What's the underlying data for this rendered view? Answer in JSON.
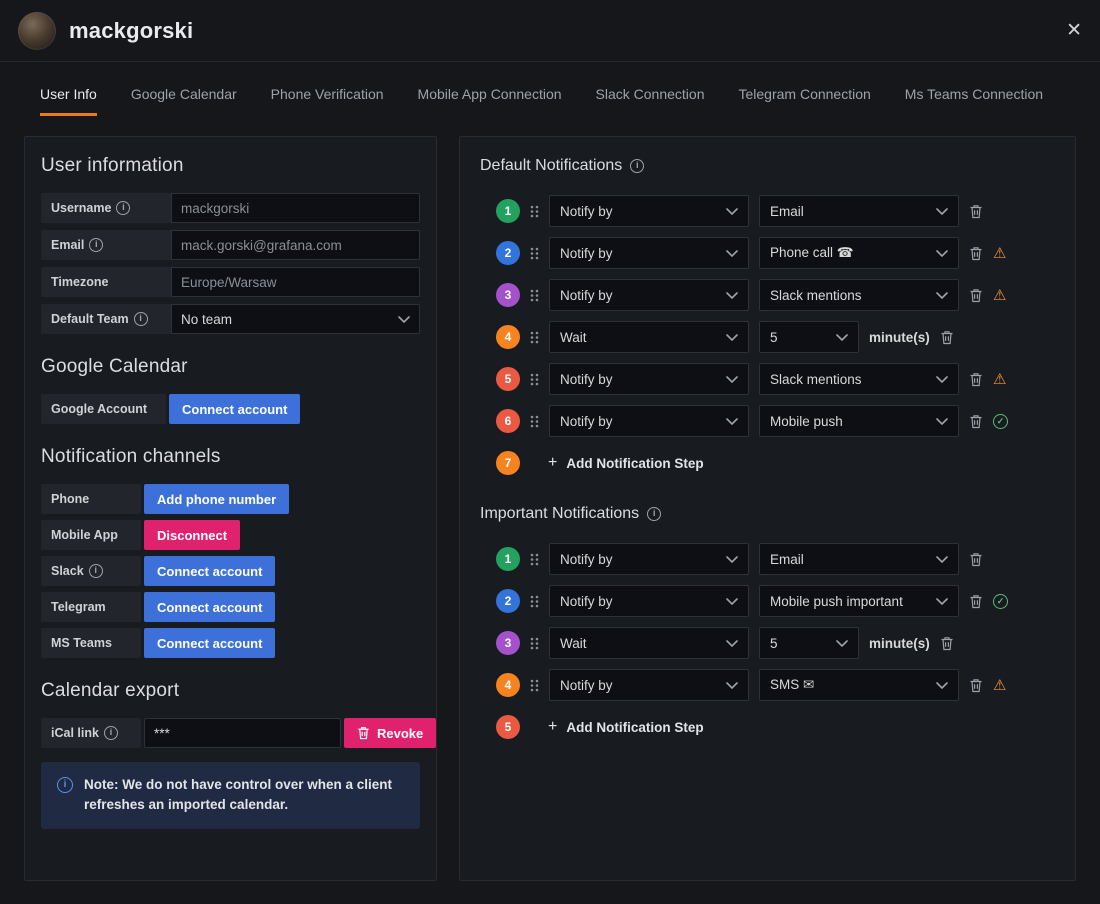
{
  "colors": {
    "primary_button": "#3d71d9",
    "danger_button": "#e0226e",
    "active_tab_accent": "#eb7b18",
    "warning_icon": "#f6953b",
    "success_icon": "#5cb97a",
    "note_info_icon": "#5794f2"
  },
  "icons": {
    "close": "✕",
    "info": "i",
    "warning": "⚠",
    "check": "✓",
    "plus": "+"
  },
  "header": {
    "title": "mackgorski"
  },
  "tabs": [
    {
      "label": "User Info"
    },
    {
      "label": "Google Calendar"
    },
    {
      "label": "Phone Verification"
    },
    {
      "label": "Mobile App Connection"
    },
    {
      "label": "Slack Connection"
    },
    {
      "label": "Telegram Connection"
    },
    {
      "label": "Ms Teams Connection"
    }
  ],
  "user_info": {
    "heading": "User information",
    "fields": [
      {
        "label": "Username",
        "info": true,
        "value": "mackgorski"
      },
      {
        "label": "Email",
        "info": true,
        "value": "mack.gorski@grafana.com"
      },
      {
        "label": "Timezone",
        "info": false,
        "value": "Europe/Warsaw"
      },
      {
        "label": "Default Team",
        "info": true,
        "value": "No team"
      }
    ]
  },
  "google_calendar": {
    "heading": "Google Calendar",
    "label": "Google Account",
    "button": "Connect account"
  },
  "channels": {
    "heading": "Notification channels",
    "items": [
      {
        "label": "Phone",
        "info": false,
        "button": "Add phone number"
      },
      {
        "label": "Mobile App",
        "info": false,
        "button": "Disconnect"
      },
      {
        "label": "Slack",
        "info": true,
        "button": "Connect account"
      },
      {
        "label": "Telegram",
        "info": false,
        "button": "Connect account"
      },
      {
        "label": "MS Teams",
        "info": false,
        "button": "Connect account"
      }
    ]
  },
  "calendar_export": {
    "heading": "Calendar export",
    "label": "iCal link",
    "info": true,
    "value": "***",
    "revoke_label": "Revoke",
    "note": "Note: We do not have control over when a client refreshes an imported calendar."
  },
  "notifications": {
    "default": {
      "title": "Default Notifications",
      "steps": [
        {
          "num": "1",
          "color": "#23a25f",
          "action": "Notify by",
          "channel": "Email",
          "warn": false,
          "ok": false
        },
        {
          "num": "2",
          "color": "#3274d9",
          "action": "Notify by",
          "channel": "Phone call ☎",
          "warn": true,
          "ok": false
        },
        {
          "num": "3",
          "color": "#a352cc",
          "action": "Notify by",
          "channel": "Slack mentions",
          "warn": true,
          "ok": false
        },
        {
          "num": "4",
          "color": "#f5831f",
          "action": "Wait",
          "wait_value": "5",
          "suffix": "minute(s)",
          "warn": false,
          "ok": false
        },
        {
          "num": "5",
          "color": "#ea5a42",
          "action": "Notify by",
          "channel": "Slack mentions",
          "warn": true,
          "ok": false
        },
        {
          "num": "6",
          "color": "#ea5a42",
          "action": "Notify by",
          "channel": "Mobile push",
          "warn": false,
          "ok": true
        }
      ],
      "add_step": {
        "num": "7",
        "color": "#f5831f",
        "label": "Add Notification Step"
      }
    },
    "important": {
      "title": "Important Notifications",
      "steps": [
        {
          "num": "1",
          "color": "#23a25f",
          "action": "Notify by",
          "channel": "Email",
          "warn": false,
          "ok": false
        },
        {
          "num": "2",
          "color": "#3274d9",
          "action": "Notify by",
          "channel": "Mobile push important",
          "warn": false,
          "ok": true
        },
        {
          "num": "3",
          "color": "#a352cc",
          "action": "Wait",
          "wait_value": "5",
          "suffix": "minute(s)",
          "warn": false,
          "ok": false
        },
        {
          "num": "4",
          "color": "#f5831f",
          "action": "Notify by",
          "channel": "SMS ✉",
          "warn": true,
          "ok": false
        }
      ],
      "add_step": {
        "num": "5",
        "color": "#ea5a42",
        "label": "Add Notification Step"
      }
    }
  }
}
